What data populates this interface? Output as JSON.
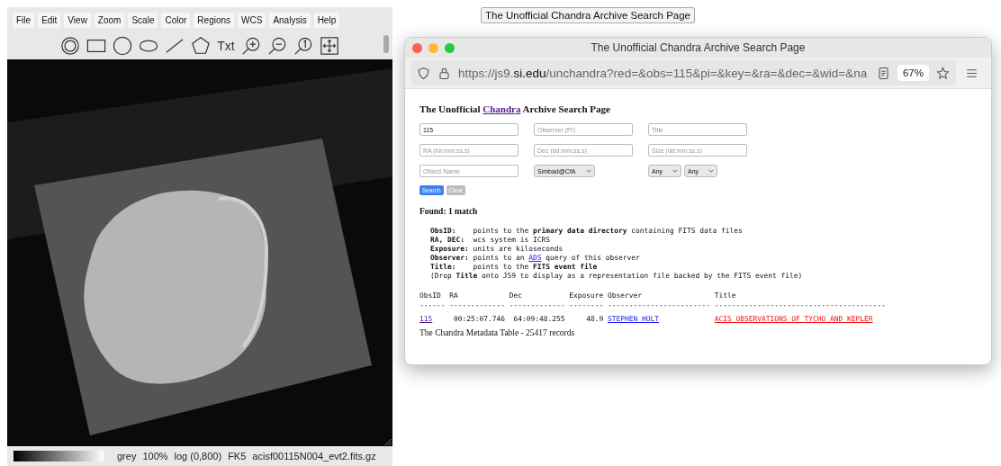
{
  "viewer": {
    "menus": [
      "File",
      "Edit",
      "View",
      "Zoom",
      "Scale",
      "Color",
      "Regions",
      "WCS",
      "Analysis",
      "Help"
    ],
    "tools": [
      {
        "kind": "annulus"
      },
      {
        "kind": "box"
      },
      {
        "kind": "circle"
      },
      {
        "kind": "ellipse"
      },
      {
        "kind": "line"
      },
      {
        "kind": "polygon"
      },
      {
        "kind": "text",
        "label": "Txt"
      },
      {
        "kind": "zoom_in"
      },
      {
        "kind": "zoom_out"
      },
      {
        "kind": "zoom_one"
      },
      {
        "kind": "fit"
      }
    ],
    "status": [
      "grey",
      "100%",
      "log (0,800)",
      "FK5",
      "acisf00115N004_evt2.fits.gz"
    ]
  },
  "floating_label": "The Unofficial Chandra Archive Search Page",
  "browser": {
    "title": "The Unofficial Chandra Archive Search Page",
    "url": "https://js9.**si.edu**/unchandra?red=&obs=115&pi=&key=&ra=&dec=&wid=&na",
    "zoom": "67%",
    "page": {
      "heading": {
        "before": "The Unofficial ",
        "link": "Chandra",
        "after": " Archive Search Page"
      },
      "form_rows": [
        [
          {
            "kind": "input",
            "value": "115"
          },
          {
            "kind": "input",
            "placeholder": "Observer (PI)"
          },
          {
            "kind": "input",
            "placeholder": "Title"
          }
        ],
        [
          {
            "kind": "input",
            "placeholder": "RA (hh:mm:ss.s)"
          },
          {
            "kind": "input",
            "placeholder": "Dec (dd:mm:ss.s)"
          },
          {
            "kind": "input",
            "placeholder": "Size (dd:mm:ss.s)"
          }
        ],
        [
          {
            "kind": "input",
            "placeholder": "Object Name"
          },
          {
            "kind": "select",
            "value": "Simbad@CfA"
          },
          {
            "kind": "selects",
            "values": [
              "Any",
              "Any"
            ]
          }
        ]
      ],
      "buttons": [
        {
          "label": "Search",
          "disabled": false
        },
        {
          "label": "Clear",
          "disabled": true
        }
      ],
      "found": "Found: 1 match",
      "legend": [
        {
          "text": "**ObsID:**    points to the **primary data directory** containing FITS data files"
        },
        {
          "text": "**RA, DEC:**  wcs system is ICRS"
        },
        {
          "text": "**Exposure:** units are kiloseconds"
        },
        {
          "text": "**Observer:** points to an ",
          "link": "ADS",
          "after": " query of this observer"
        },
        {
          "text": "**Title:**    points to the **FITS event file**"
        },
        {
          "text": "(Drop **Title** onto JS9 to display as a representation file backed by the FITS event file)"
        }
      ],
      "table": {
        "columns": [
          {
            "label": "ObsID",
            "rule": "------"
          },
          {
            "label": "RA",
            "rule": "-------------"
          },
          {
            "label": "Dec",
            "rule": "-------------"
          },
          {
            "label": "Exposure",
            "rule": "--------"
          },
          {
            "label": "Observer",
            "rule": "------------------------"
          },
          {
            "label": "Title",
            "rule": "----------------------------------------"
          }
        ],
        "rows": [
          [
            {
              "kind": "visited_link",
              "text": "115"
            },
            {
              "kind": "text",
              "text": "00:25:07.746"
            },
            {
              "kind": "text",
              "text": "64:09:48.255"
            },
            {
              "kind": "text",
              "text": "48.9"
            },
            {
              "kind": "link",
              "text": "STEPHEN HOLT"
            },
            {
              "kind": "alert_link",
              "text": "ACIS OBSERVATIONS OF TYCHO AND KEPLER"
            }
          ]
        ]
      },
      "footer": "The Chandra Metadata Table - 25417 records"
    }
  }
}
